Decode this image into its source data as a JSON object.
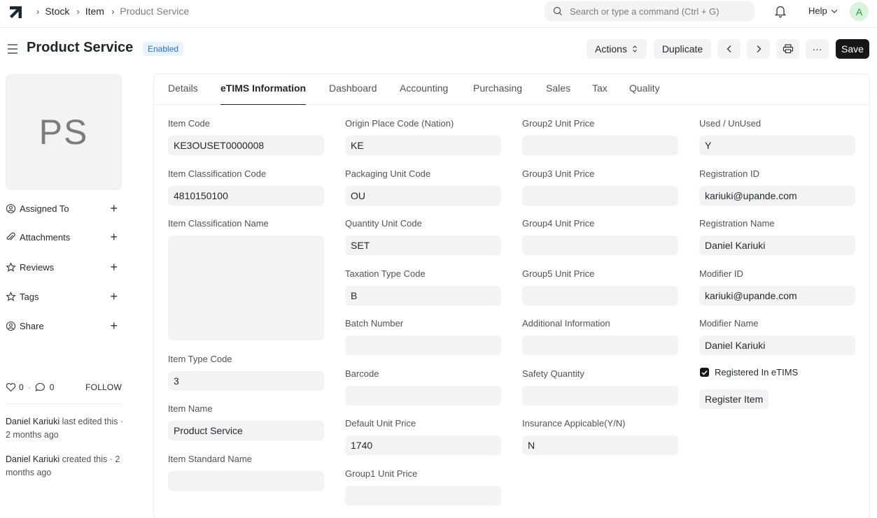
{
  "navbar": {
    "breadcrumbs": [
      "Stock",
      "Item",
      "Product Service"
    ],
    "search_placeholder": "Search or type a command (Ctrl + G)",
    "help_label": "Help",
    "avatar_initial": "A"
  },
  "page": {
    "title": "Product Service",
    "status": "Enabled",
    "actions_label": "Actions",
    "duplicate_label": "Duplicate",
    "more_label": "···",
    "save_label": "Save"
  },
  "sidebar": {
    "image_initials": "PS",
    "items": [
      {
        "label": "Assigned To",
        "icon": "user-icon"
      },
      {
        "label": "Attachments",
        "icon": "paperclip-icon"
      },
      {
        "label": "Reviews",
        "icon": "star-icon"
      },
      {
        "label": "Tags",
        "icon": "tag-icon"
      },
      {
        "label": "Share",
        "icon": "share-icon"
      }
    ],
    "likes": "0",
    "comments": "0",
    "follow_label": "FOLLOW",
    "activity": [
      {
        "user": "Daniel Kariuki",
        "text": " last edited this · 2 months ago"
      },
      {
        "user": "Daniel Kariuki",
        "text": " created this · 2 months ago"
      }
    ]
  },
  "tabs": [
    "Details",
    "eTIMS Information",
    "Dashboard",
    "Accounting",
    "Purchasing",
    "Sales",
    "Tax",
    "Quality"
  ],
  "columns": [
    [
      {
        "label": "Item Code",
        "value": "KE3OUSET0000008"
      },
      {
        "label": "Item Classification Code",
        "value": "4810150100"
      },
      {
        "label": "Item Classification Name",
        "value": "",
        "textarea": true
      },
      {
        "label": "Item Type Code",
        "value": "3"
      },
      {
        "label": "Item Name",
        "value": "Product Service"
      },
      {
        "label": "Item Standard Name",
        "value": ""
      }
    ],
    [
      {
        "label": "Origin Place Code (Nation)",
        "value": "KE"
      },
      {
        "label": "Packaging Unit Code",
        "value": "OU"
      },
      {
        "label": "Quantity Unit Code",
        "value": "SET"
      },
      {
        "label": "Taxation Type Code",
        "value": "B"
      },
      {
        "label": "Batch Number",
        "value": ""
      },
      {
        "label": "Barcode",
        "value": ""
      },
      {
        "label": "Default Unit Price",
        "value": "1740"
      },
      {
        "label": "Group1 Unit Price",
        "value": ""
      }
    ],
    [
      {
        "label": "Group2 Unit Price",
        "value": ""
      },
      {
        "label": "Group3 Unit Price",
        "value": ""
      },
      {
        "label": "Group4 Unit Price",
        "value": ""
      },
      {
        "label": "Group5 Unit Price",
        "value": ""
      },
      {
        "label": "Additional Information",
        "value": ""
      },
      {
        "label": "Safety Quantity",
        "value": ""
      },
      {
        "label": "Insurance Appicable(Y/N)",
        "value": "N"
      }
    ],
    [
      {
        "label": "Used / UnUsed",
        "value": "Y"
      },
      {
        "label": "Registration ID",
        "value": "kariuki@upande.com"
      },
      {
        "label": "Registration Name",
        "value": "Daniel Kariuki"
      },
      {
        "label": "Modifier ID",
        "value": "kariuki@upande.com"
      },
      {
        "label": "Modifier Name",
        "value": "Daniel Kariuki"
      }
    ]
  ],
  "registered_label": "Registered In eTIMS",
  "register_button": "Register Item"
}
